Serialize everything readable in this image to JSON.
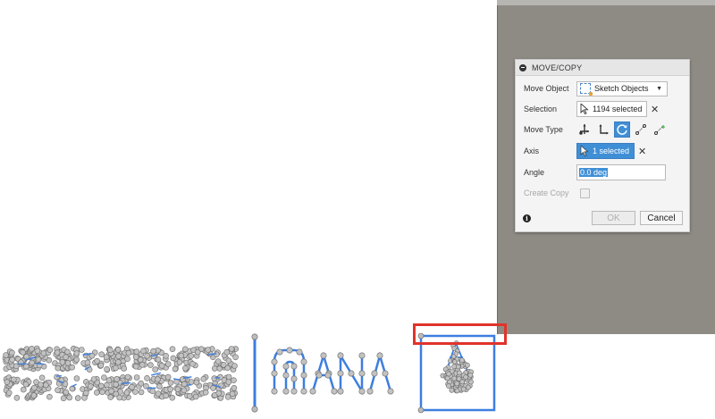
{
  "dialog": {
    "title": "MOVE/COPY",
    "move_object": {
      "label": "Move Object",
      "value": "Sketch Objects"
    },
    "selection": {
      "label": "Selection",
      "value": "1194 selected"
    },
    "move_type": {
      "label": "Move Type"
    },
    "axis": {
      "label": "Axis",
      "value": "1 selected"
    },
    "angle": {
      "label": "Angle",
      "value": "0.0 deg"
    },
    "create_copy": {
      "label": "Create Copy"
    },
    "ok_label": "OK",
    "cancel_label": "Cancel"
  },
  "icons": {
    "move_types": [
      "free-move-icon",
      "translate-icon",
      "rotate-icon",
      "point-to-point-icon",
      "point-to-position-icon"
    ],
    "info": "info-icon",
    "clear": "close-icon"
  },
  "colors": {
    "accent_blue": "#3f8fd6",
    "highlight_red": "#e0332b",
    "sketch_line": "#3d7ee0",
    "viewport_gray": "#8e8b85"
  }
}
